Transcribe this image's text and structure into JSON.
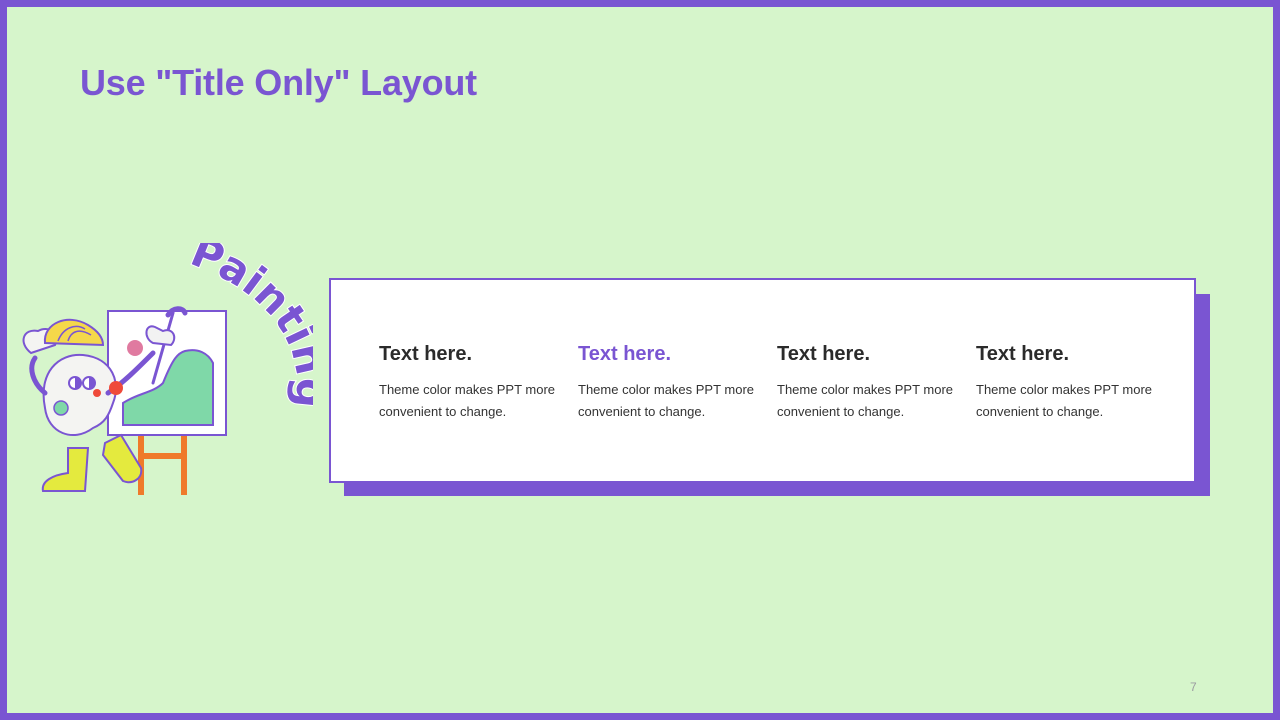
{
  "slide": {
    "title": "Use \"Title Only\" Layout",
    "page_number": "7"
  },
  "illustration": {
    "word": "Painting"
  },
  "columns": [
    {
      "heading": "Text here.",
      "body": "Theme color makes PPT more convenient  to change.",
      "accent": false
    },
    {
      "heading": "Text here.",
      "body": "Theme color makes PPT more convenient  to change.",
      "accent": true
    },
    {
      "heading": "Text here.",
      "body": "Theme color makes PPT more convenient  to change.",
      "accent": false
    },
    {
      "heading": "Text here.",
      "body": "Theme color makes PPT more convenient  to change.",
      "accent": false
    }
  ],
  "colors": {
    "background": "#d6f5cb",
    "accent": "#7a55d2",
    "heading_text": "#2b2b2b",
    "card": "#ffffff"
  }
}
